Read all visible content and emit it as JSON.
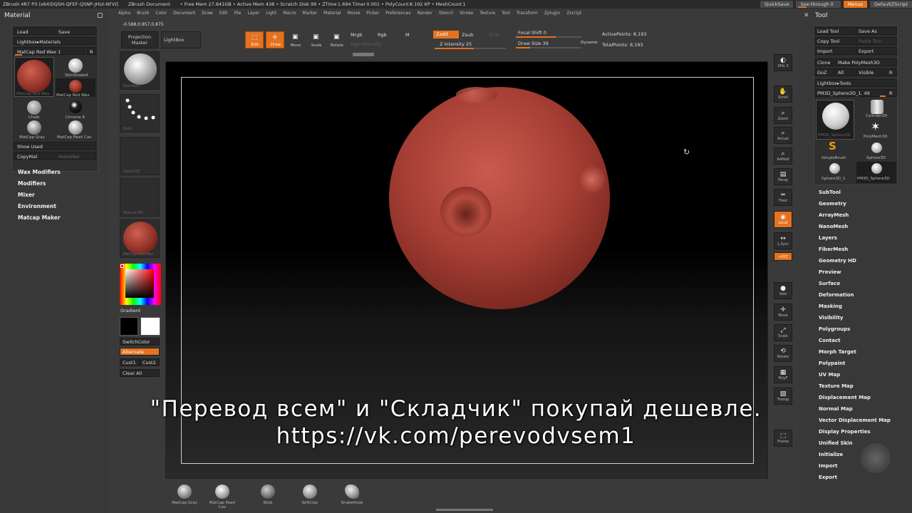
{
  "titlebar": {
    "items": [
      "ZBrush 4R7 P3 (x64)[IQSH-QFEF-QSNP-JHUI-NFVI]",
      "ZBrush Document",
      "• Free Mem 27.841GB • Active Mem 438 • Scratch Disk 99 • ZTime 1.694 Timer 0.001 • PolyCount 8.192 KP • MeshCount 1"
    ],
    "quicksave": "QuickSave",
    "seethrough": "See-through   0",
    "menus": "Menus",
    "script": "DefaultZScript"
  },
  "menubar": [
    "Alpha",
    "Brush",
    "Color",
    "Document",
    "Draw",
    "Edit",
    "File",
    "Layer",
    "Light",
    "Macro",
    "Marker",
    "Material",
    "Movie",
    "Picker",
    "Preferences",
    "Render",
    "Stencil",
    "Stroke",
    "Texture",
    "Tool",
    "Transform",
    "Zplugin",
    "Zscript"
  ],
  "coords": "-0.588,0.857,0.875",
  "toolbar": {
    "projection": "Projection",
    "projection2": "Master",
    "lightbox": "LightBox",
    "edit": "Edit",
    "draw": "Draw",
    "move": "Move",
    "scale": "Scale",
    "rotate": "Rotate",
    "mrgb": "Mrgb",
    "rgb": "Rgb",
    "m": "M",
    "rgb_intensity": "Rgb  Intensity",
    "zadd": "Zadd",
    "zsub": "Zsub",
    "zcut": "Zcut",
    "z_intensity": "Z Intensity 25",
    "focal_shift": "Focal Shift 0",
    "draw_size": "Draw Size 39",
    "dynamic": "Dynamic",
    "active_points": "ActivePoints: 8,193",
    "total_points": "TotalPoints: 8,193"
  },
  "material_palette": {
    "title": "Material",
    "load": "Load",
    "save": "Save",
    "lightbox_materials": "Lightbox▸Materials",
    "current": "MatCap Red Wax 1",
    "r": "R",
    "items": [
      "MatCap Red Wax",
      "SkinShade4",
      "MatCap Red Wax",
      "Chalk",
      "Chrome A",
      "MatCap Gray",
      "MatCap Pearl Cav"
    ],
    "show_used": "Show Used",
    "copymat": "CopyMat",
    "pastemat": "PasteMat",
    "menus": [
      "Wax Modifiers",
      "Modifiers",
      "Mixer",
      "Environment",
      "Matcap Maker"
    ]
  },
  "shelf": {
    "standard": "Standard",
    "dots": "Dots",
    "alpha_off": "Alpha Off",
    "texture_off": "Texture Off",
    "matcap": "MatCap Red Wax",
    "gradient": "Gradient",
    "switchcolor": "SwitchColor",
    "alternate": "Alternate",
    "cust1": "Cust1",
    "cust2": "Cust2",
    "clear_all": "Clear All"
  },
  "caption": {
    "line1": "\"Перевод всем\" и \"Складчик\" покупай дешевле.",
    "line2": "https://vk.com/perevodvsem1"
  },
  "view_controls": [
    {
      "name": "bpr",
      "icon": "◐",
      "label": "SPix 3"
    },
    {
      "name": "scroll",
      "icon": "✋",
      "label": "Scroll"
    },
    {
      "name": "zoom",
      "icon": "⌕",
      "label": "Zoom"
    },
    {
      "name": "actual",
      "icon": "⌕",
      "label": "Actual"
    },
    {
      "name": "aahalf",
      "icon": "⌕",
      "label": "AAHalf"
    },
    {
      "name": "persp",
      "icon": "▤",
      "label": "Persp"
    },
    {
      "name": "floor",
      "icon": "═",
      "label": "Floor"
    },
    {
      "name": "local",
      "icon": "◉",
      "label": "Local"
    },
    {
      "name": "lsym",
      "icon": "↔",
      "label": "L.Sym"
    },
    {
      "name": "xyz",
      "icon": "⟳",
      "label": "•XYZ"
    },
    {
      "name": "solo",
      "icon": "●",
      "label": "Solo"
    },
    {
      "name": "move",
      "icon": "✛",
      "label": "Move"
    },
    {
      "name": "scale",
      "icon": "⤢",
      "label": "Scale"
    },
    {
      "name": "rotate",
      "icon": "⟲",
      "label": "Rotate"
    },
    {
      "name": "polyf",
      "icon": "▦",
      "label": "PolyF"
    },
    {
      "name": "transp",
      "icon": "▧",
      "label": "Transp"
    },
    {
      "name": "frame",
      "icon": "⬚",
      "label": "Frame"
    }
  ],
  "tool_palette": {
    "title": "Tool",
    "load_tool": "Load Tool",
    "save_as": "Save As",
    "copy_tool": "Copy Tool",
    "paste_tool": "Paste Tool",
    "import": "Import",
    "export": "Export",
    "clone": "Clone",
    "make_polymesh": "Make PolyMesh3D",
    "goz": "GoZ",
    "all": "All",
    "visible": "Visible",
    "r": "R",
    "lightbox_tools": "Lightbox▸Tools",
    "current_tool": "PM3D_Sphere3D_1. 49",
    "thumbs": [
      "PM3D_Sphere3D",
      "Cylinder3D",
      "PolyMesh3D",
      "SimpleBrush",
      "Sphere3D",
      "Sphere3D_1",
      "PM3D_Sphere3D"
    ],
    "menus": [
      "SubTool",
      "Geometry",
      "ArrayMesh",
      "NanoMesh",
      "Layers",
      "FiberMesh",
      "Geometry HD",
      "Preview",
      "Surface",
      "Deformation",
      "Masking",
      "Visibility",
      "Polygroups",
      "Contact",
      "Morph Target",
      "Polypaint",
      "UV Map",
      "Texture Map",
      "Displacement Map",
      "Normal Map",
      "Vector Displacement Map",
      "Display Properties",
      "Unified Skin",
      "Initialize",
      "Import",
      "Export"
    ]
  },
  "bottom_shelf": [
    "MatCap Gray",
    "MatCap Pearl Cav",
    "Blob",
    "SoftClay",
    "SnakeHook"
  ]
}
